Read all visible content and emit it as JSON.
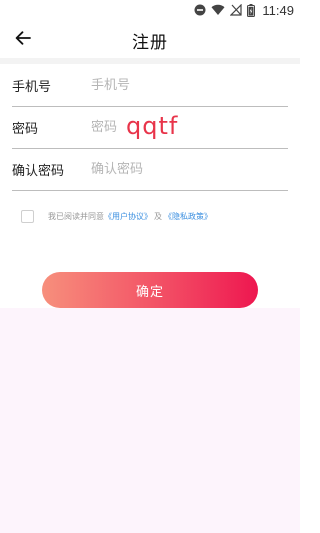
{
  "status_bar": {
    "time": "11:49",
    "icons": [
      "do-not-disturb-icon",
      "wifi-icon",
      "no-signal-icon",
      "battery-icon"
    ]
  },
  "header": {
    "back_icon": "arrow-left-icon",
    "title": "注册"
  },
  "form": {
    "phone": {
      "label": "手机号",
      "placeholder": "手机号",
      "value": ""
    },
    "password": {
      "label": "密码",
      "placeholder": "密码",
      "value": ""
    },
    "confirm_password": {
      "label": "确认密码",
      "placeholder": "确认密码",
      "value": ""
    }
  },
  "overlay_text": "qqtf",
  "agreement": {
    "checked": false,
    "prefix": "我已阅读并同意",
    "user_agreement": "《用户协议》",
    "and": "及",
    "privacy_policy": "《隐私政策》"
  },
  "confirm_button": {
    "label": "确定"
  },
  "colors": {
    "accent_start": "#f78f7c",
    "accent_end": "#ee1750",
    "link": "#3b8fe0",
    "overlay": "#e8344a"
  }
}
